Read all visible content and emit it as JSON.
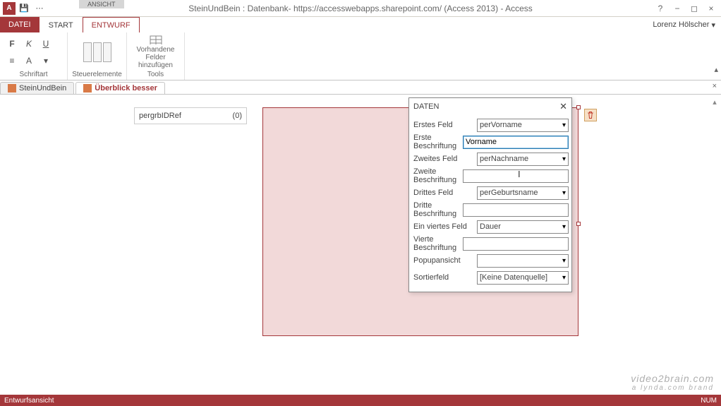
{
  "titlebar": {
    "app_initial": "A",
    "title": "SteinUndBein : Datenbank- https://accesswebapps.sharepoint.com/ (Access 2013) - Access",
    "ctx_label": "ANSICHT"
  },
  "window_controls": {
    "help": "?",
    "min": "−",
    "max": "◻",
    "close": "×"
  },
  "qat": {
    "save": "💾",
    "more": "⋯"
  },
  "user": {
    "name": "Lorenz Hölscher",
    "chev": "▾"
  },
  "ribbon_tabs": {
    "file": "DATEI",
    "start": "START",
    "entwurf": "ENTWURF"
  },
  "ribbon": {
    "group1_label": "Schriftart",
    "group2_label": "Steuerelemente",
    "group3_label": "Tools",
    "group3_btn": "Vorhandene\nFelder hinzufügen",
    "bold": "F",
    "italic": "K",
    "underline": "U",
    "align": "≡",
    "fontcolor": "A",
    "more": "▾"
  },
  "navtabs": {
    "tab1": "SteinUndBein",
    "tab2": "Überblick besser",
    "close": "×"
  },
  "fieldlist": {
    "name": "pergrbIDRef",
    "count": "(0)"
  },
  "panel": {
    "title": "DATEN",
    "rows": {
      "r1_label": "Erstes Feld",
      "r1_value": "perVorname",
      "r2_label": "Erste Beschriftung",
      "r2_value": "Vorname",
      "r3_label": "Zweites Feld",
      "r3_value": "perNachname",
      "r4_label": "Zweite Beschriftung",
      "r4_value": "",
      "r5_label": "Drittes Feld",
      "r5_value": "perGeburtsname",
      "r6_label": "Dritte Beschriftung",
      "r6_value": "",
      "r7_label": "Ein viertes Feld",
      "r7_value": "Dauer",
      "r8_label": "Vierte Beschriftung",
      "r8_value": "",
      "r9_label": "Popupansicht",
      "r9_value": "",
      "r10_label": "Sortierfeld",
      "r10_value": "[Keine Datenquelle]"
    }
  },
  "statusbar": {
    "left": "Entwurfsansicht",
    "right": "NUM"
  },
  "watermark": {
    "main": "video2brain.com",
    "sub": "a lynda.com brand"
  },
  "glyphs": {
    "chev_down": "▾",
    "chev_up": "▴",
    "caret": "I"
  }
}
